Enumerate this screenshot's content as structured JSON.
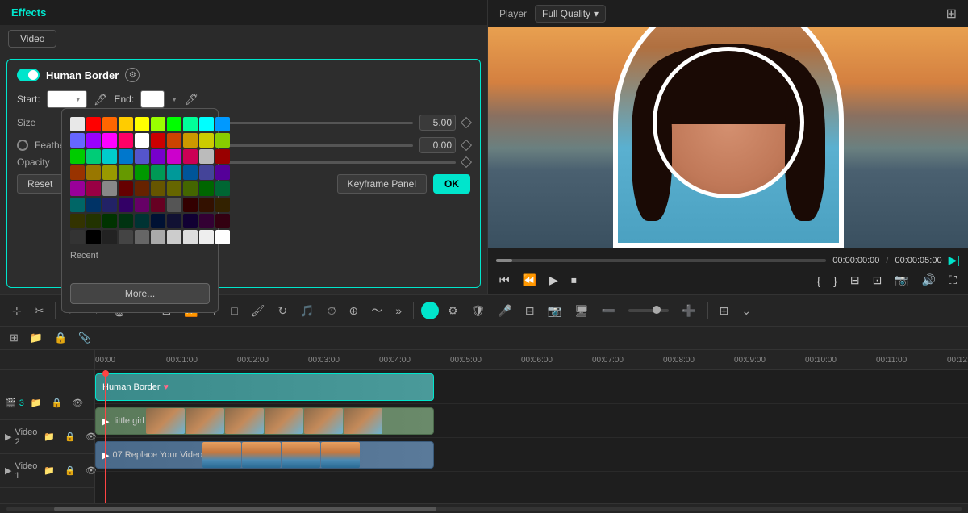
{
  "app": {
    "effects_title": "Effects",
    "video_tab": "Video",
    "effect_name": "Human Border",
    "start_label": "Start:",
    "end_label": "End:",
    "size_label": "Size",
    "feather_label": "Feather",
    "opacity_label": "Opacity",
    "size_value": "5.00",
    "feather_value": "0.00",
    "opacity_value": "",
    "size_percent": 45,
    "feather_percent": 0,
    "recent_label": "Recent",
    "more_btn": "More...",
    "reset_btn": "Reset",
    "keyframe_panel_btn": "Keyframe Panel",
    "ok_btn": "OK",
    "player_label": "Player",
    "quality_label": "Full Quality",
    "time_current": "00:00:00:00",
    "time_total": "00:00:05:00",
    "clip_hb_name": "Human Border",
    "clip_video_name": "little girl",
    "clip_bg_name": "07 Replace Your Video",
    "track3_label": "Video 3",
    "track2_label": "Video 2",
    "track1_label": "Video 1",
    "palette_colors": [
      "#e8e8e8",
      "#ff0000",
      "#ff6600",
      "#ffcc00",
      "#ffff00",
      "#99ff00",
      "#00ff00",
      "#00ff99",
      "#00ffff",
      "#0099ff",
      "#6666ff",
      "#9900ff",
      "#ff00ff",
      "#ff0066",
      "#ffffff",
      "#cc0000",
      "#cc4400",
      "#cc9900",
      "#cccc00",
      "#88cc00",
      "#00cc00",
      "#00cc77",
      "#00cccc",
      "#0077cc",
      "#5555cc",
      "#7700cc",
      "#cc00cc",
      "#cc0055",
      "#bbbbbb",
      "#990000",
      "#993300",
      "#997700",
      "#999900",
      "#669900",
      "#009900",
      "#009955",
      "#009999",
      "#005599",
      "#444499",
      "#550099",
      "#990099",
      "#990044",
      "#888888",
      "#660000",
      "#662200",
      "#665500",
      "#666600",
      "#446600",
      "#006600",
      "#006633",
      "#006666",
      "#003366",
      "#222266",
      "#330066",
      "#660066",
      "#660022",
      "#555555",
      "#330000",
      "#331100",
      "#332200",
      "#333300",
      "#223300",
      "#003300",
      "#003311",
      "#003333",
      "#001133",
      "#111133",
      "#110033",
      "#330033",
      "#330011",
      "#333333",
      "#000000",
      "#222222",
      "#444444",
      "#666666",
      "#aaaaaa",
      "#cccccc",
      "#dddddd",
      "#eeeeee",
      "#ffffff"
    ],
    "ruler_marks": [
      "00:00",
      "00:01:00",
      "00:02:00",
      "00:03:00",
      "00:04:00",
      "00:05:00",
      "00:06:00",
      "00:07:00",
      "00:08:00",
      "00:09:00",
      "00:10:00",
      "00:11:00",
      "00:12:00"
    ]
  }
}
